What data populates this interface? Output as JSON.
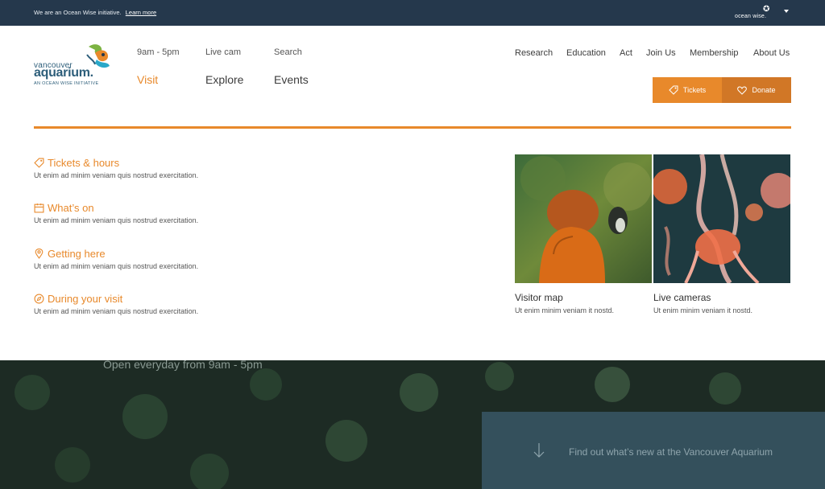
{
  "topbar": {
    "notice": "We are an Ocean Wise initiative.",
    "learn_more": "Learn more",
    "ow_logo": "ocean wise."
  },
  "logo": {
    "line1": "vancouver",
    "line2": "aquarium.",
    "tagline": "AN OCEAN WISE INITIATIVE"
  },
  "utility_nav": {
    "hours": "9am - 5pm",
    "live_cam": "Live cam",
    "search": "Search"
  },
  "main_nav": {
    "visit": "Visit",
    "explore": "Explore",
    "events": "Events"
  },
  "secondary_nav": [
    "Research",
    "Education",
    "Act",
    "Join Us",
    "Membership",
    "About Us"
  ],
  "buttons": {
    "tickets": "Tickets",
    "donate": "Donate"
  },
  "menu": [
    {
      "title": "Tickets & hours",
      "desc": "Ut enim ad minim veniam quis nostrud exercitation.",
      "icon": "tag-icon"
    },
    {
      "title": "What’s on",
      "desc": "Ut enim ad minim veniam quis nostrud exercitation.",
      "icon": "calendar-icon"
    },
    {
      "title": "Getting here",
      "desc": "Ut enim ad minim veniam quis nostrud exercitation.",
      "icon": "map-pin-icon"
    },
    {
      "title": "During your visit",
      "desc": "Ut enim ad minim veniam quis nostrud exercitation.",
      "icon": "compass-icon"
    }
  ],
  "cards": [
    {
      "title": "Visitor map",
      "desc": "Ut enim minim veniam it nostd."
    },
    {
      "title": "Live cameras",
      "desc": "Ut enim minim veniam it nostd."
    }
  ],
  "hero": {
    "open_text": "Open everyday from 9am - 5pm",
    "panel_text": "Find out what’s new at the Vancouver Aquarium"
  },
  "colors": {
    "accent": "#e8892b",
    "topbar": "#25384c",
    "brand_blue": "#2d5e7a"
  }
}
